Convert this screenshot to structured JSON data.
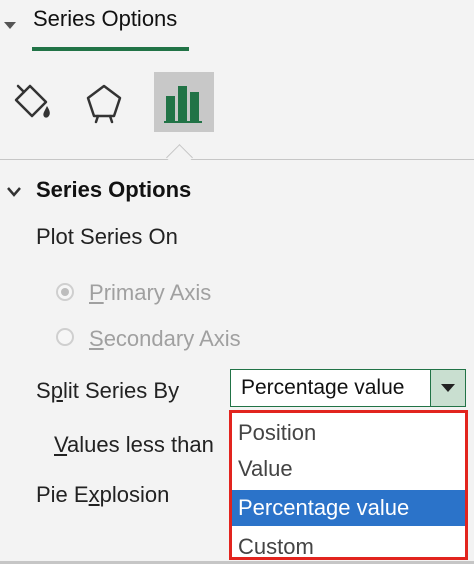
{
  "header": {
    "title": "Series Options"
  },
  "tabs": [
    {
      "icon": "fill-line-icon"
    },
    {
      "icon": "effects-icon"
    },
    {
      "icon": "series-options-icon",
      "selected": true
    }
  ],
  "section": {
    "title": "Series Options"
  },
  "plot_series_on": {
    "label": "Plot Series On",
    "primary_prefix": "P",
    "primary_rest": "rimary Axis",
    "secondary_prefix": "S",
    "secondary_rest": "econdary Axis",
    "selected": "Primary Axis"
  },
  "split": {
    "label_a": "S",
    "label_u": "p",
    "label_b": "lit Series By",
    "value": "Percentage value"
  },
  "values_less_than": {
    "label_u": "V",
    "label_b": "alues less than"
  },
  "pie_explosion": {
    "label_a": "Pie E",
    "label_u": "x",
    "label_b": "plosion"
  },
  "dropdown": {
    "options": [
      "Position",
      "Value",
      "Percentage value",
      "Custom"
    ],
    "selected": "Percentage value"
  },
  "colors": {
    "accent": "#217346",
    "highlight": "#e2241e",
    "selection": "#2b73c9"
  }
}
